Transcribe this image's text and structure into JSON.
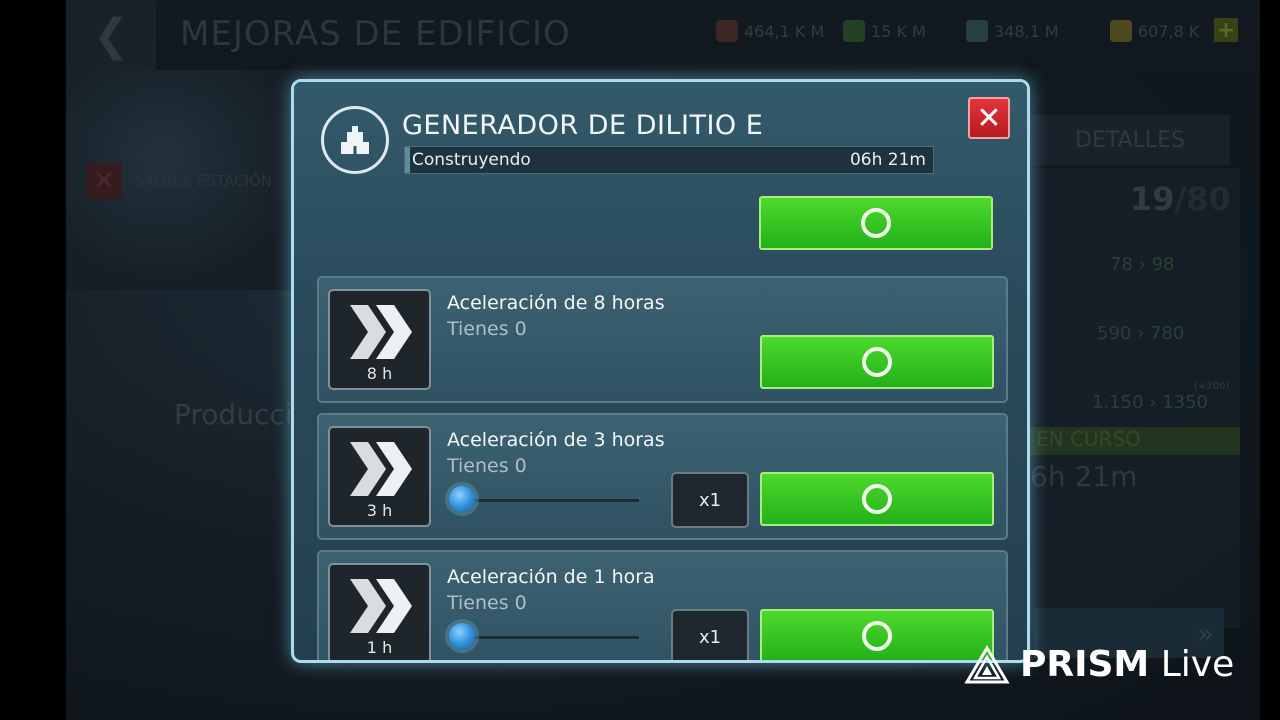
{
  "background": {
    "header_title": "MEJORAS DE EDIFICIO",
    "back_glyph": "❮",
    "resources": [
      {
        "value": "464,1 K M",
        "icon": "tritanium-icon",
        "color": "#6b3f38"
      },
      {
        "value": "15 K M",
        "icon": "dilithium-icon",
        "color": "#3c6d3a"
      },
      {
        "value": "348,1 M",
        "icon": "parsteel-icon",
        "color": "#3f6a70"
      },
      {
        "value": "607,8 K",
        "icon": "latinum-icon",
        "color": "#8a7a2e"
      }
    ],
    "plus_label": "+",
    "exit_label": "SALIR A ESTACIÓN",
    "exit_glyph": "✕",
    "production_label": "Producci",
    "details_tab": "DETALLES",
    "level_current": "19",
    "level_max": "/80",
    "stats": [
      {
        "from": "78",
        "to": "98"
      },
      {
        "from": "590",
        "to": "780"
      },
      {
        "from": "1.150",
        "to": "1350"
      }
    ],
    "bonus_label": "(+200)",
    "status_banner": "EN CURSO",
    "status_time": "6h 21m",
    "speedup_glyph": "»"
  },
  "modal": {
    "title": "GENERADOR DE DILITIO E",
    "icon": "building-icon",
    "progress": {
      "label": "Construyendo",
      "time": "06h 21m",
      "fraction": 0.01
    },
    "close_glyph": "✕",
    "items": [
      {
        "name": "Aceleración de 8 horas",
        "owned": "Tienes 0",
        "tile_label": "8 h",
        "has_slider": false,
        "quantity": ""
      },
      {
        "name": "Aceleración de 3 horas",
        "owned": "Tienes 0",
        "tile_label": "3 h",
        "has_slider": true,
        "slider_value": 0,
        "quantity": "x1"
      },
      {
        "name": "Aceleración de 1 hora",
        "owned": "Tienes 0",
        "tile_label": "1 h",
        "has_slider": true,
        "slider_value": 0,
        "quantity": "x1"
      }
    ]
  },
  "watermark": {
    "brand": "PRISM",
    "suffix": "Live",
    "icon": "prism-logo-icon"
  }
}
